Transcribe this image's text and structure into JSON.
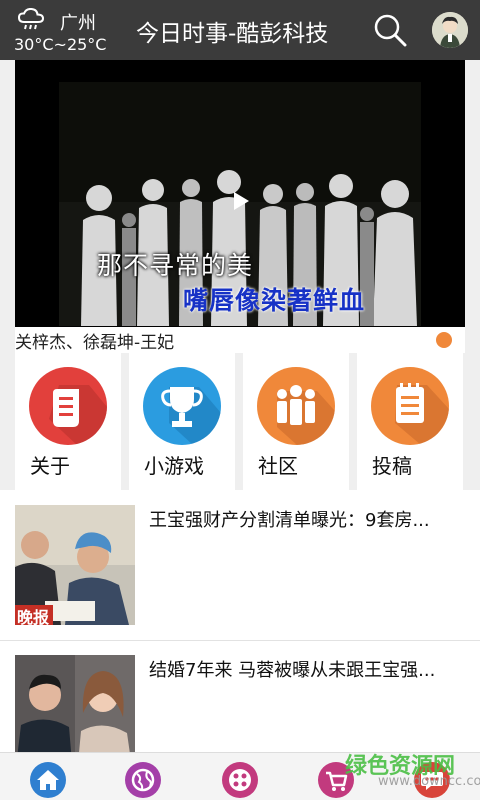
{
  "header": {
    "city": "广州",
    "temperature": "30°C~25°C",
    "title": "今日时事-酷彭科技",
    "weather_icon": "rain-cloud-icon",
    "search_icon": "search-icon",
    "avatar_icon": "avatar"
  },
  "banner": {
    "lyric_line1": "那不寻常的美",
    "lyric_line2": "嘴唇像染著鲜血",
    "caption": "关梓杰、徐磊坤-王妃",
    "indicator_color": "#f0883a"
  },
  "categories": [
    {
      "label": "关于",
      "icon": "scroll-icon",
      "color": "#e2403c"
    },
    {
      "label": "小游戏",
      "icon": "trophy-icon",
      "color": "#2b9ce0"
    },
    {
      "label": "社区",
      "icon": "people-icon",
      "color": "#f0883a"
    },
    {
      "label": "投稿",
      "icon": "notepad-icon",
      "color": "#f0883a"
    }
  ],
  "news": [
    {
      "title": "王宝强财产分割清单曝光：9套房...",
      "thumb_tag": "晚报"
    },
    {
      "title": "结婚7年来  马蓉被曝从未跟王宝强..."
    }
  ],
  "bottom_nav": [
    {
      "icon": "home-icon",
      "color": "#2f7fd0"
    },
    {
      "icon": "globe-icon",
      "color": "#a43fa8"
    },
    {
      "icon": "apps-icon",
      "color": "#c23a7e"
    },
    {
      "icon": "cart-icon",
      "color": "#c23a7e"
    },
    {
      "icon": "chat-icon",
      "color": "#d8443a"
    }
  ],
  "watermark": {
    "text": "绿色资源网",
    "url": "www.downcc.com"
  }
}
